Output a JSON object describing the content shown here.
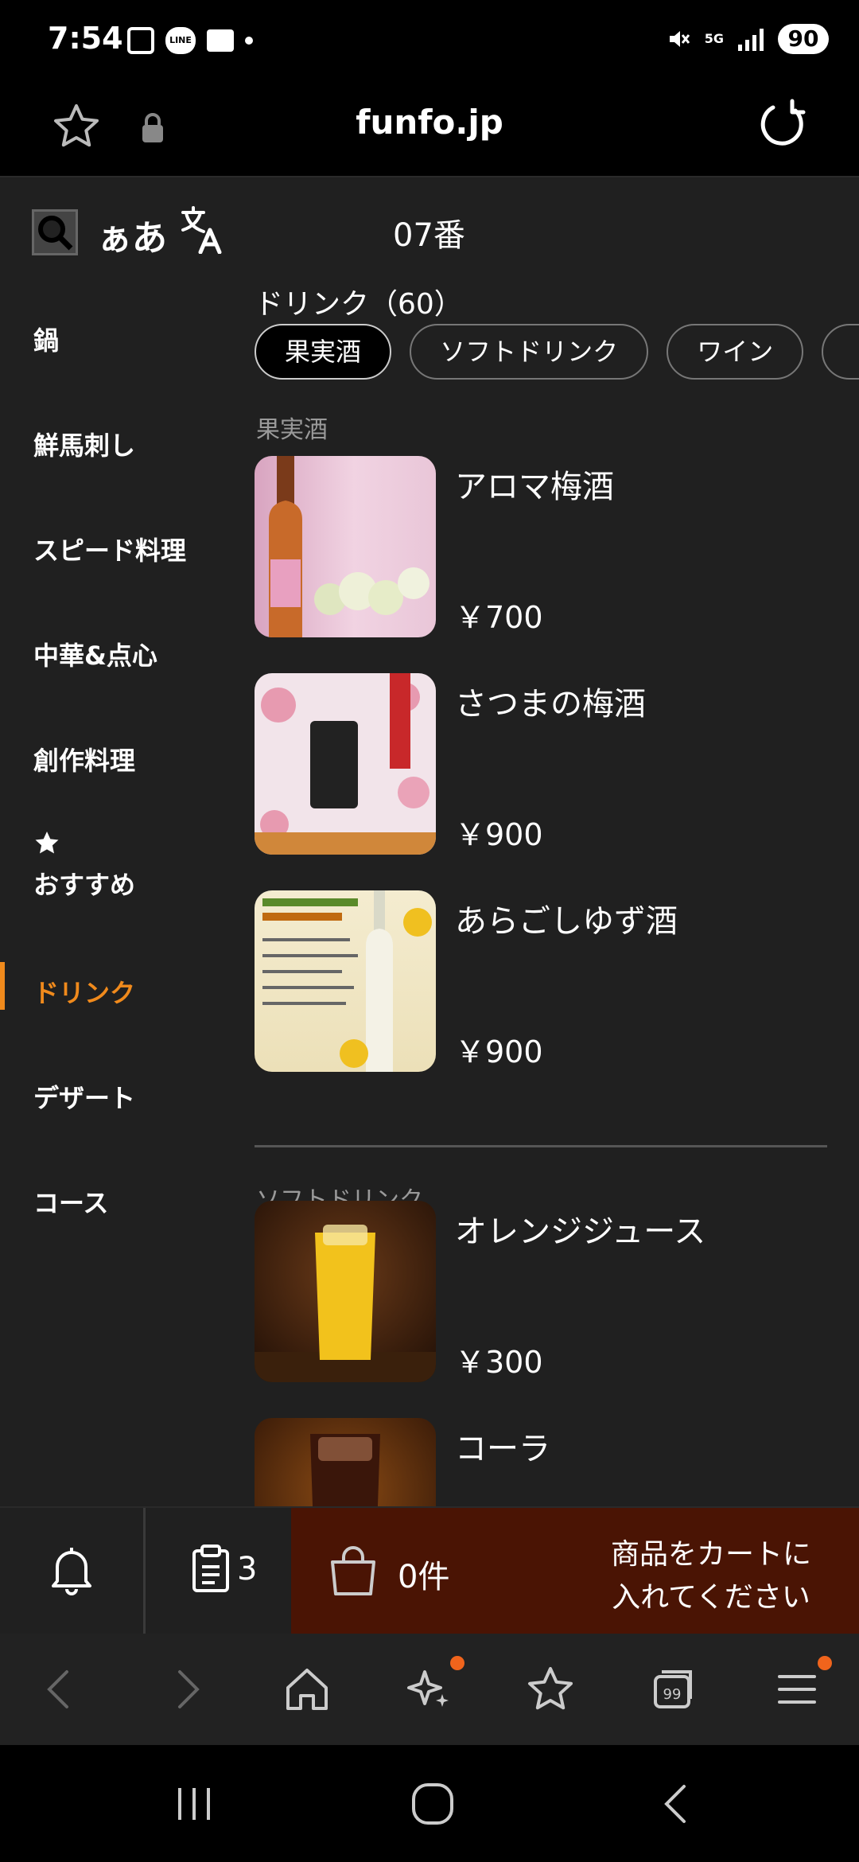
{
  "status_bar": {
    "time": "7:54",
    "line_label": "LINE",
    "network": "5G",
    "battery": "90"
  },
  "browser": {
    "domain": "funfo.jp"
  },
  "toolbar": {
    "font_size_label": "ぁあ",
    "table_number": "07番"
  },
  "sidebar": {
    "categories": [
      {
        "label": "鍋"
      },
      {
        "label": "鮮馬刺し"
      },
      {
        "label": "スピード料理"
      },
      {
        "label": "中華&点心"
      },
      {
        "label": "創作料理"
      },
      {
        "label": "おすすめ",
        "icon": "star-icon"
      },
      {
        "label": "ドリンク",
        "active": true
      },
      {
        "label": "デザート"
      },
      {
        "label": "コース"
      }
    ]
  },
  "menu": {
    "section_title": "ドリンク（60）",
    "chips": [
      "果実酒",
      "ソフトドリンク",
      "ワイン"
    ],
    "selected_chip": "果実酒",
    "groups": [
      {
        "title": "果実酒",
        "items": [
          {
            "name": "アロマ梅酒",
            "price": "￥700",
            "image": "aroma-umeshu-bottle"
          },
          {
            "name": "さつまの梅酒",
            "price": "￥900",
            "image": "satsuma-umeshu-label"
          },
          {
            "name": "あらごしゆず酒",
            "price": "￥900",
            "image": "yuzu-sake-ad"
          }
        ]
      },
      {
        "title": "ソフトドリンク",
        "items": [
          {
            "name": "オレンジジュース",
            "price": "￥300",
            "image": "orange-juice-glass"
          },
          {
            "name": "コーラ",
            "price": "",
            "image": "cola-glass"
          }
        ]
      }
    ]
  },
  "action_bar": {
    "orders_count": "3",
    "cart_count": "0件",
    "cart_message": "商品をカートに入れてください",
    "cart_color": "#4a1404"
  },
  "colors": {
    "accent": "#f08a1c",
    "badge": "#f0641c",
    "background": "#202020"
  }
}
